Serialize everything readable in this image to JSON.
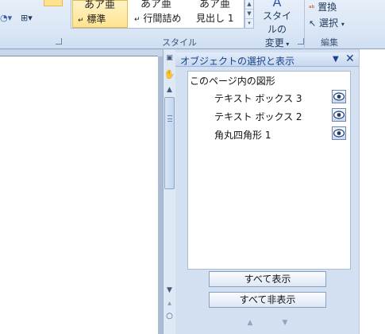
{
  "ribbon": {
    "styles_group_label": "スタイル",
    "edit_group_label": "編集",
    "style_gallery": [
      {
        "preview": "あア亜",
        "label": "標準",
        "selected": true
      },
      {
        "preview": "あア亜",
        "label": "行間詰め",
        "selected": false
      },
      {
        "preview": "あア亜",
        "label": "見出し 1",
        "selected": false
      }
    ],
    "change_styles_line1": "スタイルの",
    "change_styles_line2": "変更",
    "replace_label": "置換",
    "select_label": "選択"
  },
  "pane": {
    "title": "オブジェクトの選択と表示",
    "caption": "このページ内の図形",
    "shapes": [
      {
        "name": "テキスト ボックス 3",
        "visible": true
      },
      {
        "name": "テキスト ボックス 2",
        "visible": true
      },
      {
        "name": "角丸四角形 1",
        "visible": true
      }
    ],
    "show_all": "すべて表示",
    "hide_all": "すべて非表示"
  }
}
